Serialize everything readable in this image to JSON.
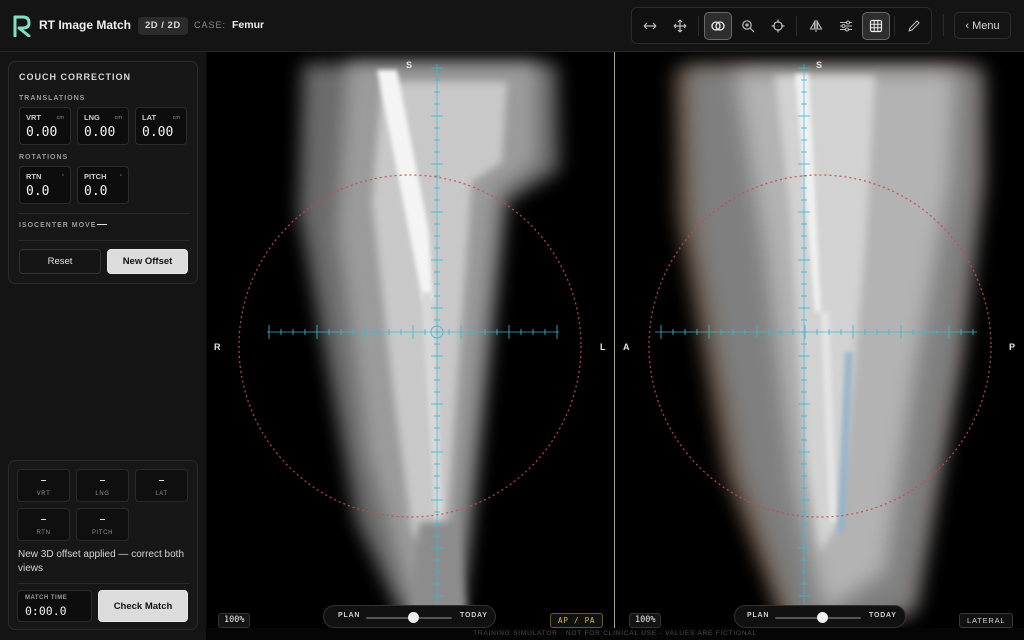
{
  "header": {
    "app_title": "RT Image Match",
    "mode_badge": "2D / 2D",
    "case_label": "CASE:",
    "case_value": "Femur",
    "menu_label": "Menu"
  },
  "toolbar": {
    "tools": [
      "pan-horizontal",
      "move",
      "blend-overlay",
      "zoom",
      "crosshair",
      "flip",
      "window-level",
      "grid",
      "draw"
    ],
    "active": [
      "blend-overlay",
      "grid"
    ]
  },
  "couch_correction": {
    "title": "COUCH CORRECTION",
    "translations_label": "TRANSLATIONS",
    "translations": [
      {
        "label": "VRT",
        "unit": "cm",
        "value": "0.00"
      },
      {
        "label": "LNG",
        "unit": "cm",
        "value": "0.00"
      },
      {
        "label": "LAT",
        "unit": "cm",
        "value": "0.00"
      }
    ],
    "rotations_label": "ROTATIONS",
    "rotations": [
      {
        "label": "RTN",
        "unit": "°",
        "value": "0.0"
      },
      {
        "label": "PITCH",
        "unit": "°",
        "value": "0.0"
      }
    ],
    "isocenter_label": "ISOCENTER MOVE",
    "isocenter_value": "—",
    "reset_label": "Reset",
    "new_offset_label": "New Offset"
  },
  "results": {
    "translations": [
      {
        "label": "VRT",
        "value": "–"
      },
      {
        "label": "LNG",
        "value": "–"
      },
      {
        "label": "LAT",
        "value": "–"
      }
    ],
    "rotations": [
      {
        "label": "RTN",
        "value": "–"
      },
      {
        "label": "PITCH",
        "value": "–"
      }
    ],
    "status": "New 3D offset applied — correct both views",
    "match_time_label": "MATCH TIME",
    "match_time": "0:00.0",
    "check_label": "Check Match"
  },
  "viewers": {
    "left": {
      "orient_top": "S",
      "orient_left": "R",
      "orient_right": "L",
      "zoom": "100%",
      "plan_label": "PLAN",
      "today_label": "TODAY",
      "blend_fraction": 0.55,
      "view_tag": "AP / PA"
    },
    "right": {
      "orient_top": "S",
      "orient_left": "A",
      "orient_right": "P",
      "zoom": "100%",
      "plan_label": "PLAN",
      "today_label": "TODAY",
      "blend_fraction": 0.55,
      "view_tag": "LATERAL"
    }
  },
  "footer": "TRAINING SIMULATOR · NOT FOR CLINICAL USE · VALUES ARE FICTIONAL",
  "colors": {
    "accent_graticule": "#3fb6d4",
    "target_circle": "#c84b4b",
    "ap_tag": "#d9b84a"
  }
}
